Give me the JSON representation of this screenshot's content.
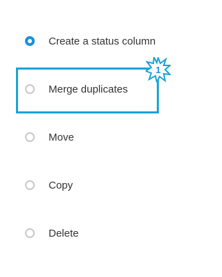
{
  "options": [
    {
      "label": "Create a status column",
      "selected": true
    },
    {
      "label": "Merge duplicates",
      "selected": false
    },
    {
      "label": "Move",
      "selected": false
    },
    {
      "label": "Copy",
      "selected": false
    },
    {
      "label": "Delete",
      "selected": false
    }
  ],
  "highlight": {
    "step_number": "1",
    "color": "#1aa3d9"
  },
  "colors": {
    "selected_radio": "#1a8fe0",
    "unselected_radio": "#c8c8c8",
    "text": "#333333"
  }
}
